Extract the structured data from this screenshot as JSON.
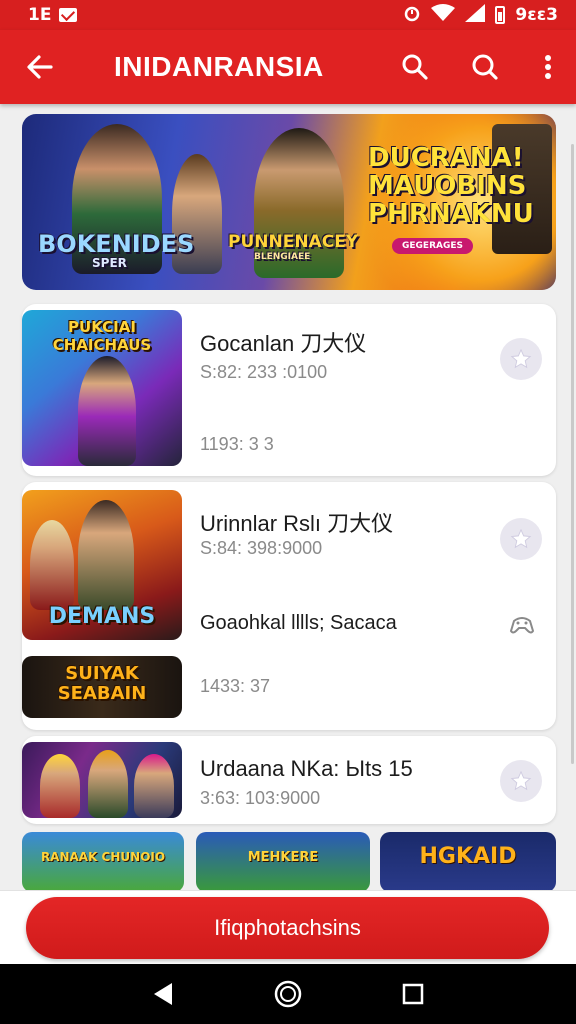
{
  "status_bar": {
    "left_text": "1E",
    "right_text": "9ɛɛ3"
  },
  "app_bar": {
    "title": "INIDANRANSIA",
    "icons": [
      "back-arrow-icon",
      "search-icon",
      "search-icon",
      "more-vert-icon"
    ]
  },
  "banner": {
    "left_title": "BOKENIDES",
    "left_subtitle": "SPER",
    "center_title": "PUNNENACEY",
    "center_subtitle": "BLENGIAEE",
    "right_title": "DUCRANA! MAUOBINS PHRNAKNU",
    "right_badge": "GEGERAGES",
    "colors": {
      "left": "#1d2a7a",
      "right": "#ef6a12"
    }
  },
  "list": {
    "items": [
      {
        "thumb_label": "PUKCIAI CHAICHAUS",
        "title": "Gocanlan 刀大仪",
        "meta": "S:82: 233 :0100",
        "meta2": "1193: 3 3"
      },
      {
        "thumb_label": "DEMANS",
        "title": "Urinnlar Rslı 刀大仪",
        "meta": "S:84: 398:9000",
        "subtitle": "Goaohkal lllls; Sacaca",
        "thumb2_label": "SUIYAK SEABAIN",
        "meta2": "1433: 37"
      },
      {
        "thumb_label": "",
        "title": "Urdaana NKa: Ыts 15",
        "meta": "3:63: 103:9000"
      }
    ]
  },
  "mini_thumbs": [
    {
      "label": "RANAAK CHUNOIO"
    },
    {
      "label": "MEHKERE"
    },
    {
      "label": "HGKAID"
    }
  ],
  "cta": {
    "label": "Ifiqphotachsins",
    "color": "#d71f1f"
  },
  "nav": {
    "icons": [
      "back-triangle-icon",
      "home-circle-icon",
      "recents-square-icon"
    ]
  }
}
